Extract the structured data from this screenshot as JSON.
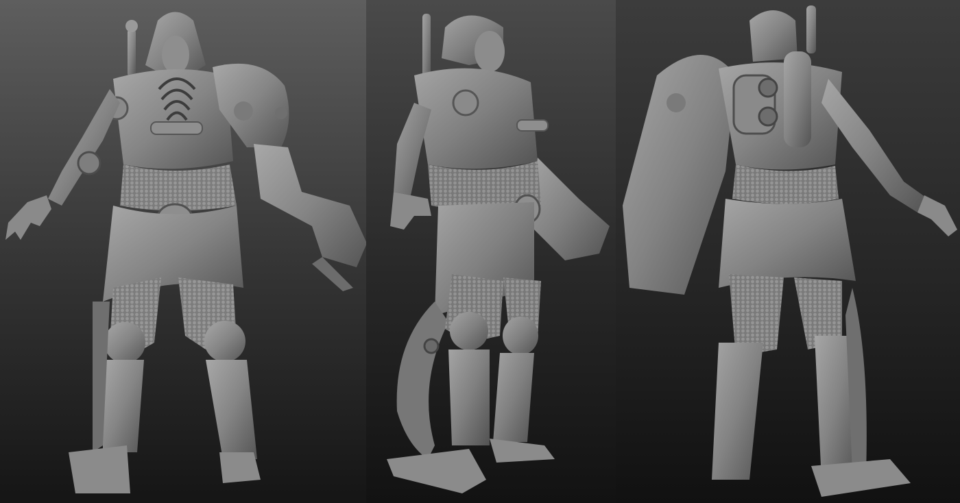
{
  "scene": {
    "views": [
      {
        "name": "front"
      },
      {
        "name": "three-quarter"
      },
      {
        "name": "back"
      }
    ],
    "background_top": "#5d5d5d",
    "background_bottom": "#141414",
    "model_light": "#9a9a9a",
    "model_mid": "#7a7a7a",
    "model_dark": "#4a4a4a"
  }
}
